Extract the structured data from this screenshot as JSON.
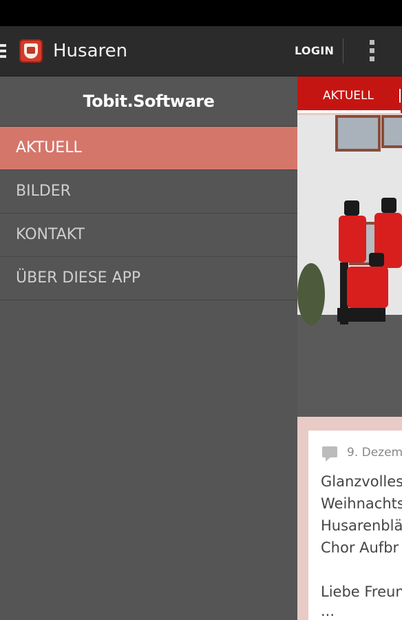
{
  "action_bar": {
    "title": "Husaren",
    "login_label": "LOGIN",
    "menu_icon": "hamburger-icon",
    "overflow_icon": "more-vertical-icon",
    "app_icon": "husaren-crest-icon"
  },
  "drawer": {
    "brand": "Tobit.Software",
    "items": [
      {
        "label": "AKTUELL",
        "active": true
      },
      {
        "label": "BILDER",
        "active": false
      },
      {
        "label": "KONTAKT",
        "active": false
      },
      {
        "label": "ÜBER DIESE APP",
        "active": false
      }
    ]
  },
  "content": {
    "tab_label": "AKTUELL",
    "post": {
      "date": "9. Dezem",
      "title_lines": [
        "Glanzvolles",
        "Weihnachts",
        "Husarenblä",
        "Chor Aufbr"
      ],
      "body_line": "Liebe Freun",
      "more": "..."
    }
  },
  "colors": {
    "action_bar": "#2b2b2b",
    "drawer": "#555555",
    "drawer_active": "#d5766a",
    "tab_bar": "#c51512",
    "content_bg": "#e9cbc6"
  }
}
